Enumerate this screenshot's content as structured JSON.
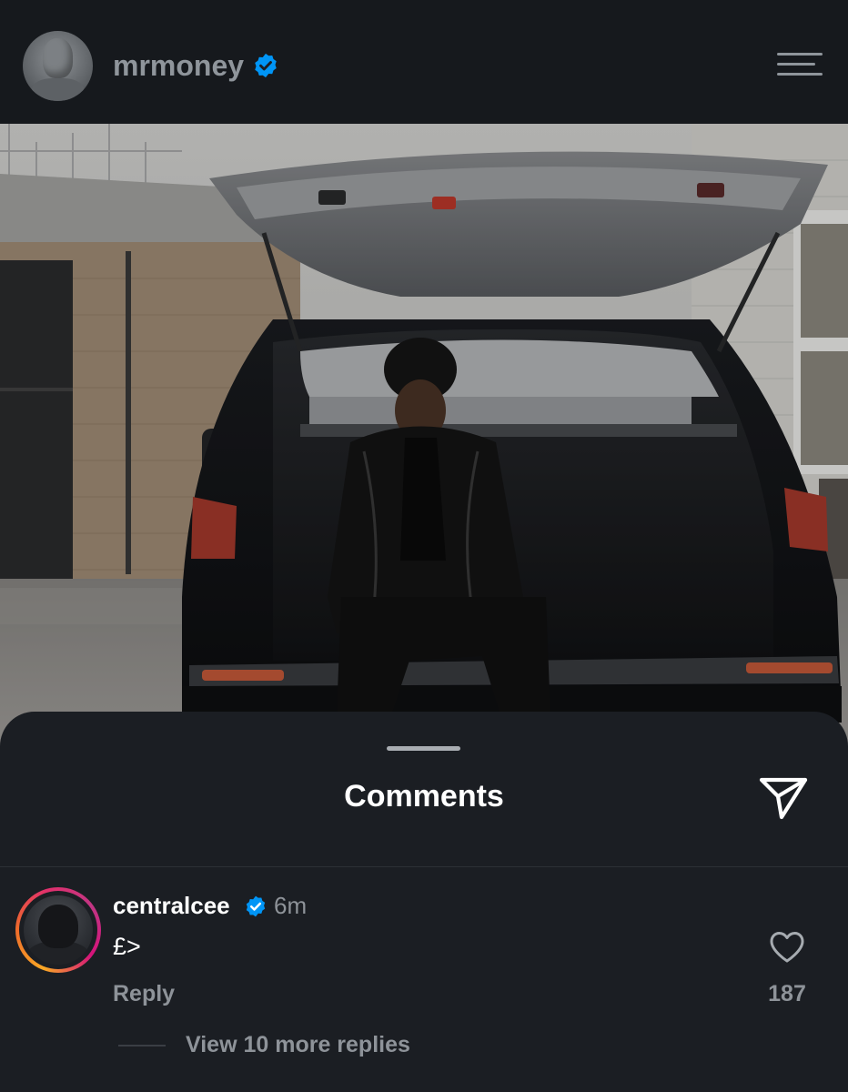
{
  "post": {
    "username": "mrmoney",
    "verified": true,
    "photo_description": "man in black leather jacket and beanie sitting in open boot of black SUV"
  },
  "comments_sheet": {
    "title": "Comments",
    "comments": [
      {
        "username": "centralcee",
        "verified": true,
        "time": "6m",
        "text": "£>",
        "reply_label": "Reply",
        "likes": "187",
        "view_replies_label": "View 10 more replies"
      }
    ]
  },
  "icons": {
    "menu": "menu-icon",
    "share": "send-icon",
    "like": "heart-icon",
    "verified": "verified-badge-icon"
  },
  "colors": {
    "background": "#1b1e23",
    "header_background": "#16191d",
    "verified_blue": "#0095f6",
    "muted_text": "#8e9399",
    "story_ring": [
      "#f9a825",
      "#e1306c",
      "#c13584"
    ]
  }
}
